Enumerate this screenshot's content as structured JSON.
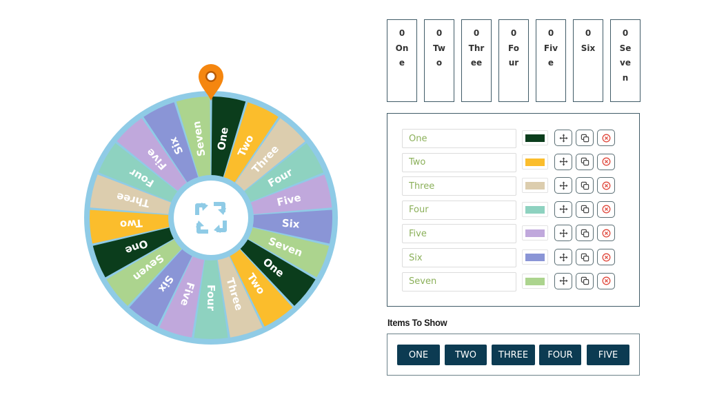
{
  "wheel": {
    "pointer_icon": "map-pin-icon",
    "pointer_color": "#f5860f",
    "rim_color": "#8fcbe6",
    "hub_color": "#ffffff",
    "center_icon": "spin-arrows-icon",
    "center_icon_color": "#8fcbe6",
    "segments": [
      {
        "label": "One",
        "color": "#0b3d1c"
      },
      {
        "label": "Two",
        "color": "#fbbd2c"
      },
      {
        "label": "Three",
        "color": "#dccdae"
      },
      {
        "label": "Four",
        "color": "#8ed2c0"
      },
      {
        "label": "Five",
        "color": "#c0a8dc"
      },
      {
        "label": "Six",
        "color": "#8a95d6"
      },
      {
        "label": "Seven",
        "color": "#acd48e"
      },
      {
        "label": "One",
        "color": "#0b3d1c"
      },
      {
        "label": "Two",
        "color": "#fbbd2c"
      },
      {
        "label": "Three",
        "color": "#dccdae"
      },
      {
        "label": "Four",
        "color": "#8ed2c0"
      },
      {
        "label": "Five",
        "color": "#c0a8dc"
      },
      {
        "label": "Six",
        "color": "#8a95d6"
      },
      {
        "label": "Seven",
        "color": "#acd48e"
      },
      {
        "label": "One",
        "color": "#0b3d1c"
      },
      {
        "label": "Two",
        "color": "#fbbd2c"
      },
      {
        "label": "Three",
        "color": "#dccdae"
      },
      {
        "label": "Four",
        "color": "#8ed2c0"
      },
      {
        "label": "Five",
        "color": "#c0a8dc"
      },
      {
        "label": "Six",
        "color": "#8a95d6"
      },
      {
        "label": "Seven",
        "color": "#acd48e"
      }
    ]
  },
  "scores": [
    {
      "count": "0",
      "name": "One"
    },
    {
      "count": "0",
      "name": "Two"
    },
    {
      "count": "0",
      "name": "Three"
    },
    {
      "count": "0",
      "name": "Four"
    },
    {
      "count": "0",
      "name": "Five"
    },
    {
      "count": "0",
      "name": "Six"
    },
    {
      "count": "0",
      "name": "Seven"
    }
  ],
  "items": [
    {
      "value": "One",
      "color": "#0b3d1c",
      "move_icon": "move-icon",
      "copy_icon": "copy-icon",
      "delete_icon": "delete-icon"
    },
    {
      "value": "Two",
      "color": "#fbbd2c",
      "move_icon": "move-icon",
      "copy_icon": "copy-icon",
      "delete_icon": "delete-icon"
    },
    {
      "value": "Three",
      "color": "#dccdae",
      "move_icon": "move-icon",
      "copy_icon": "copy-icon",
      "delete_icon": "delete-icon"
    },
    {
      "value": "Four",
      "color": "#8ed2c0",
      "move_icon": "move-icon",
      "copy_icon": "copy-icon",
      "delete_icon": "delete-icon"
    },
    {
      "value": "Five",
      "color": "#c0a8dc",
      "move_icon": "move-icon",
      "copy_icon": "copy-icon",
      "delete_icon": "delete-icon"
    },
    {
      "value": "Six",
      "color": "#8a95d6",
      "move_icon": "move-icon",
      "copy_icon": "copy-icon",
      "delete_icon": "delete-icon"
    },
    {
      "value": "Seven",
      "color": "#acd48e",
      "move_icon": "move-icon",
      "copy_icon": "copy-icon",
      "delete_icon": "delete-icon"
    }
  ],
  "items_to_show": {
    "title": "Items To Show",
    "buttons": [
      "ONE",
      "TWO",
      "THREE",
      "FOUR",
      "FIVE"
    ],
    "button_color": "#0c3b52"
  },
  "theme": {
    "delete_color": "#e0483c",
    "input_text_color": "#8bb05a"
  }
}
